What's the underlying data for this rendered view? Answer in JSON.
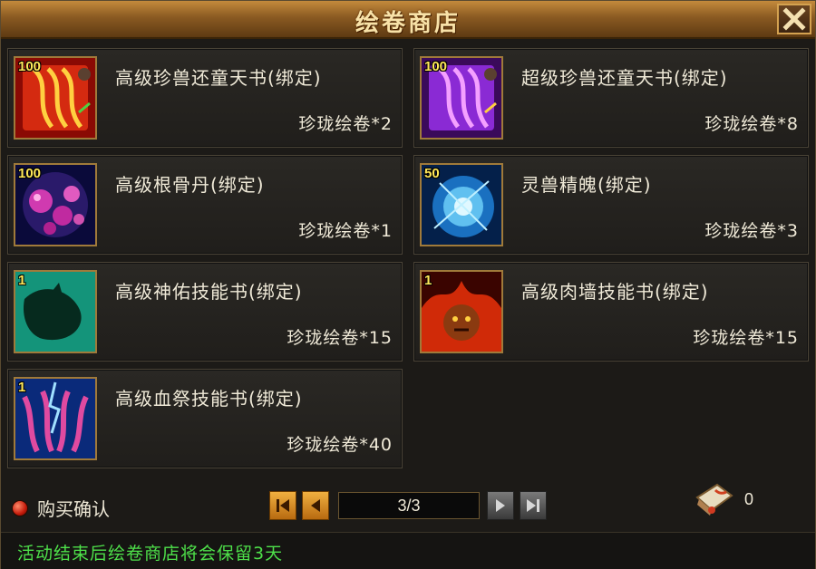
{
  "window": {
    "title": "绘卷商店"
  },
  "items": [
    {
      "name": "高级珍兽还童天书(绑定)",
      "price": "珍珑绘卷*2",
      "qty": "100",
      "icon": "red-scroll-icon"
    },
    {
      "name": "超级珍兽还童天书(绑定)",
      "price": "珍珑绘卷*8",
      "qty": "100",
      "icon": "purple-scroll-icon"
    },
    {
      "name": "高级根骨丹(绑定)",
      "price": "珍珑绘卷*1",
      "qty": "100",
      "icon": "pink-orbs-icon"
    },
    {
      "name": "灵兽精魄(绑定)",
      "price": "珍珑绘卷*3",
      "qty": "50",
      "icon": "blue-spirit-icon"
    },
    {
      "name": "高级神佑技能书(绑定)",
      "price": "珍珑绘卷*15",
      "qty": "1",
      "icon": "green-beast-icon"
    },
    {
      "name": "高级肉墙技能书(绑定)",
      "price": "珍珑绘卷*15",
      "qty": "1",
      "icon": "flame-monster-icon"
    },
    {
      "name": "高级血祭技能书(绑定)",
      "price": "珍珑绘卷*40",
      "qty": "1",
      "icon": "lightning-claws-icon"
    }
  ],
  "footer": {
    "confirm_label": "购买确认",
    "page": "3/3",
    "currency_count": "0",
    "notice": "活动结束后绘卷商店将会保留3天"
  },
  "colors": {
    "notice": "#4ee04a",
    "gold": "#d4a250",
    "qty": "#ffe85a"
  }
}
